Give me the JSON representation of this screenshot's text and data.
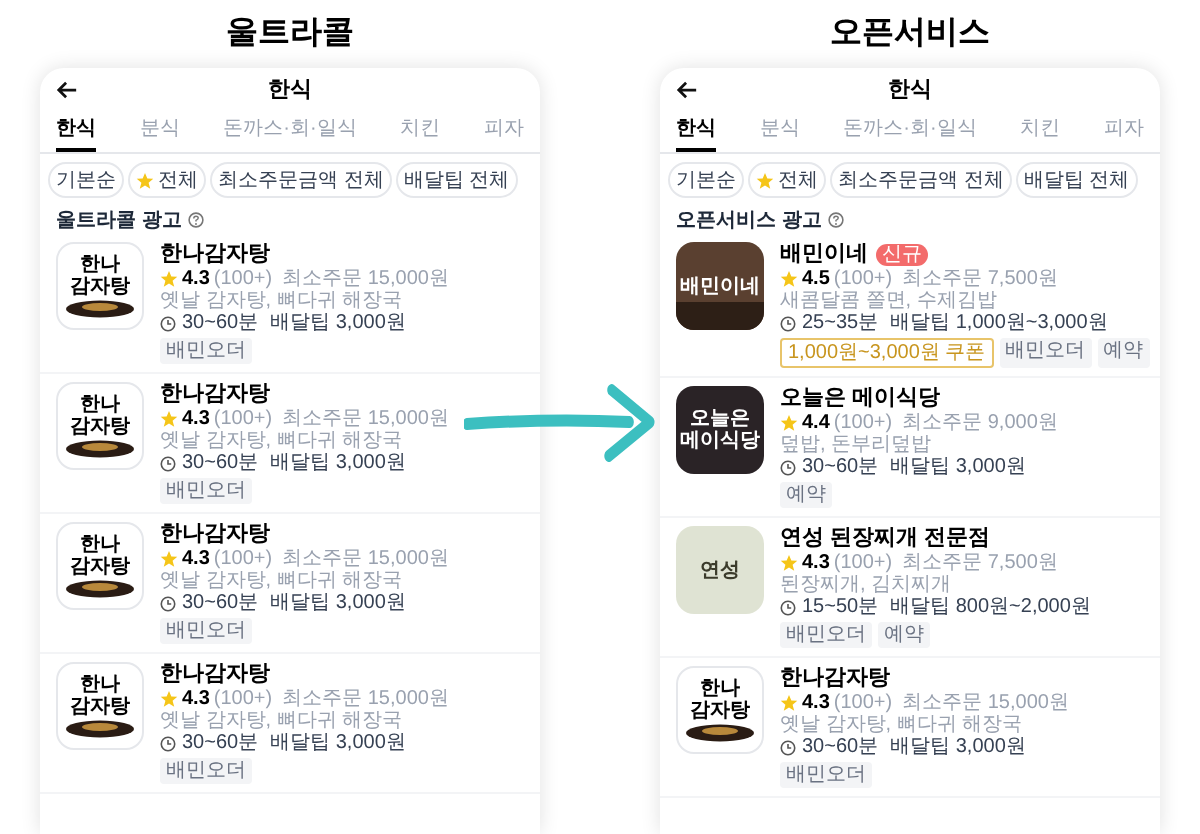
{
  "panels": [
    {
      "heading": "울트라콜",
      "screen": {
        "title": "한식",
        "tabs": [
          {
            "label": "한식",
            "selected": true
          },
          {
            "label": "분식",
            "selected": false
          },
          {
            "label": "돈까스·회·일식",
            "selected": false
          },
          {
            "label": "치킨",
            "selected": false
          },
          {
            "label": "피자",
            "selected": false
          }
        ],
        "filters": [
          {
            "kind": "plain",
            "label": "기본순"
          },
          {
            "kind": "rating",
            "label": "전체"
          },
          {
            "kind": "plain",
            "label": "최소주문금액 전체"
          },
          {
            "kind": "plain",
            "label": "배달팁 전체"
          }
        ],
        "section_label": "울트라콜 광고",
        "stores": [
          {
            "logo": {
              "kind": "bowl",
              "lines": [
                "한나",
                "감자탕"
              ]
            },
            "name": "한나감자탕",
            "rating": "4.3",
            "reviews": "(100+)",
            "minimum": "최소주문 15,000원",
            "menu": "옛날 감자탕, 뼈다귀 해장국",
            "time": "30~60분",
            "fee": "배달팁 3,000원",
            "tags": [
              {
                "kind": "plain",
                "label": "배민오더"
              }
            ]
          },
          {
            "logo": {
              "kind": "bowl",
              "lines": [
                "한나",
                "감자탕"
              ]
            },
            "name": "한나감자탕",
            "rating": "4.3",
            "reviews": "(100+)",
            "minimum": "최소주문 15,000원",
            "menu": "옛날 감자탕, 뼈다귀 해장국",
            "time": "30~60분",
            "fee": "배달팁 3,000원",
            "tags": [
              {
                "kind": "plain",
                "label": "배민오더"
              }
            ]
          },
          {
            "logo": {
              "kind": "bowl",
              "lines": [
                "한나",
                "감자탕"
              ]
            },
            "name": "한나감자탕",
            "rating": "4.3",
            "reviews": "(100+)",
            "minimum": "최소주문 15,000원",
            "menu": "옛날 감자탕, 뼈다귀 해장국",
            "time": "30~60분",
            "fee": "배달팁 3,000원",
            "tags": [
              {
                "kind": "plain",
                "label": "배민오더"
              }
            ]
          },
          {
            "logo": {
              "kind": "bowl",
              "lines": [
                "한나",
                "감자탕"
              ]
            },
            "name": "한나감자탕",
            "rating": "4.3",
            "reviews": "(100+)",
            "minimum": "최소주문 15,000원",
            "menu": "옛날 감자탕, 뼈다귀 해장국",
            "time": "30~60분",
            "fee": "배달팁 3,000원",
            "tags": [
              {
                "kind": "plain",
                "label": "배민오더"
              }
            ]
          }
        ]
      }
    },
    {
      "heading": "오픈서비스",
      "screen": {
        "title": "한식",
        "tabs": [
          {
            "label": "한식",
            "selected": true
          },
          {
            "label": "분식",
            "selected": false
          },
          {
            "label": "돈까스·회·일식",
            "selected": false
          },
          {
            "label": "치킨",
            "selected": false
          },
          {
            "label": "피자",
            "selected": false
          }
        ],
        "filters": [
          {
            "kind": "plain",
            "label": "기본순"
          },
          {
            "kind": "rating",
            "label": "전체"
          },
          {
            "kind": "plain",
            "label": "최소주문금액 전체"
          },
          {
            "kind": "plain",
            "label": "배달팁 전체"
          }
        ],
        "section_label": "오픈서비스 광고",
        "stores": [
          {
            "logo": {
              "kind": "photo",
              "lines": [
                "배민이네"
              ]
            },
            "name": "배민이네",
            "badge": "신규",
            "rating": "4.5",
            "reviews": "(100+)",
            "minimum": "최소주문 7,500원",
            "menu": "새콤달콤 쫄면, 수제김밥",
            "time": "25~35분",
            "fee": "배달팁 1,000원~3,000원",
            "tags": [
              {
                "kind": "coupon",
                "label": "1,000원~3,000원 쿠폰"
              },
              {
                "kind": "plain",
                "label": "배민오더"
              },
              {
                "kind": "plain",
                "label": "예약"
              }
            ]
          },
          {
            "logo": {
              "kind": "dark",
              "lines": [
                "오늘은",
                "메이식당"
              ]
            },
            "name": "오늘은 메이식당",
            "rating": "4.4",
            "reviews": "(100+)",
            "minimum": "최소주문 9,000원",
            "menu": "덮밥, 돈부리덮밥",
            "time": "30~60분",
            "fee": "배달팁 3,000원",
            "tags": [
              {
                "kind": "plain",
                "label": "예약"
              }
            ]
          },
          {
            "logo": {
              "kind": "pattern",
              "lines": [
                "연성"
              ]
            },
            "name": "연성 된장찌개 전문점",
            "rating": "4.3",
            "reviews": "(100+)",
            "minimum": "최소주문 7,500원",
            "menu": "된장찌개, 김치찌개",
            "time": "15~50분",
            "fee": "배달팁 800원~2,000원",
            "tags": [
              {
                "kind": "plain",
                "label": "배민오더"
              },
              {
                "kind": "plain",
                "label": "예약"
              }
            ]
          },
          {
            "logo": {
              "kind": "bowl",
              "lines": [
                "한나",
                "감자탕"
              ]
            },
            "name": "한나감자탕",
            "rating": "4.3",
            "reviews": "(100+)",
            "minimum": "최소주문 15,000원",
            "menu": "옛날 감자탕, 뼈다귀 해장국",
            "time": "30~60분",
            "fee": "배달팁 3,000원",
            "tags": [
              {
                "kind": "plain",
                "label": "배민오더"
              }
            ]
          }
        ]
      }
    }
  ]
}
